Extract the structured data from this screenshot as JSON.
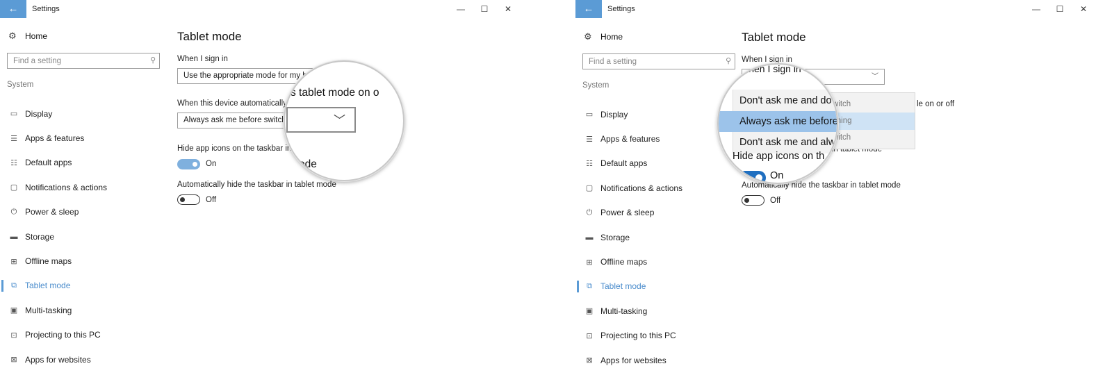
{
  "window": {
    "title": "Settings",
    "back_icon": "←",
    "minimize_icon": "—",
    "maximize_icon": "☐",
    "close_icon": "✕",
    "accent": "#5b9bd5"
  },
  "sidebar": {
    "home_label": "Home",
    "search_placeholder": "Find a setting",
    "section_label": "System",
    "items": [
      {
        "label": "Display",
        "icon": "▭"
      },
      {
        "label": "Apps & features",
        "icon": "☰"
      },
      {
        "label": "Default apps",
        "icon": "☷"
      },
      {
        "label": "Notifications & actions",
        "icon": "▢"
      },
      {
        "label": "Power & sleep",
        "icon": "⏻"
      },
      {
        "label": "Storage",
        "icon": "▬"
      },
      {
        "label": "Offline maps",
        "icon": "⊞"
      },
      {
        "label": "Tablet mode",
        "icon": "⧉",
        "active": true
      },
      {
        "label": "Multi-tasking",
        "icon": "▣"
      },
      {
        "label": "Projecting to this PC",
        "icon": "⊡"
      },
      {
        "label": "Apps for websites",
        "icon": "⊠"
      }
    ]
  },
  "content": {
    "title": "Tablet mode",
    "signin_label": "When I sign in",
    "signin_value_left": "Use the appropriate mode for my ha",
    "switch_label_left": "When this device automatically s",
    "switch_label_right": "le on or off",
    "switch_value_left": "Always ask me before switchi",
    "hide_icons_label_left": "Hide app icons on the taskbar in",
    "hide_icons_label_right": "bar in tablet mode",
    "hide_icons_state": "On",
    "hide_taskbar_label": "Automatically hide the taskbar in tablet mode",
    "hide_taskbar_state": "Off"
  },
  "dropdown_options": [
    {
      "label": "witch",
      "selected": false
    },
    {
      "label": "ching",
      "selected": true
    },
    {
      "label": "witch",
      "selected": false
    }
  ],
  "magnifier_left": {
    "line1": "s tablet mode on o",
    "line2": "ode"
  },
  "magnifier_right": {
    "top_text": "When I sign in",
    "options": [
      {
        "label": "Don't ask me and do",
        "selected": false
      },
      {
        "label": "Always ask me before",
        "selected": true
      },
      {
        "label": "Don't ask me and alw",
        "selected": false
      }
    ],
    "under_text": "Hide app icons on th",
    "toggle_state": "On"
  }
}
